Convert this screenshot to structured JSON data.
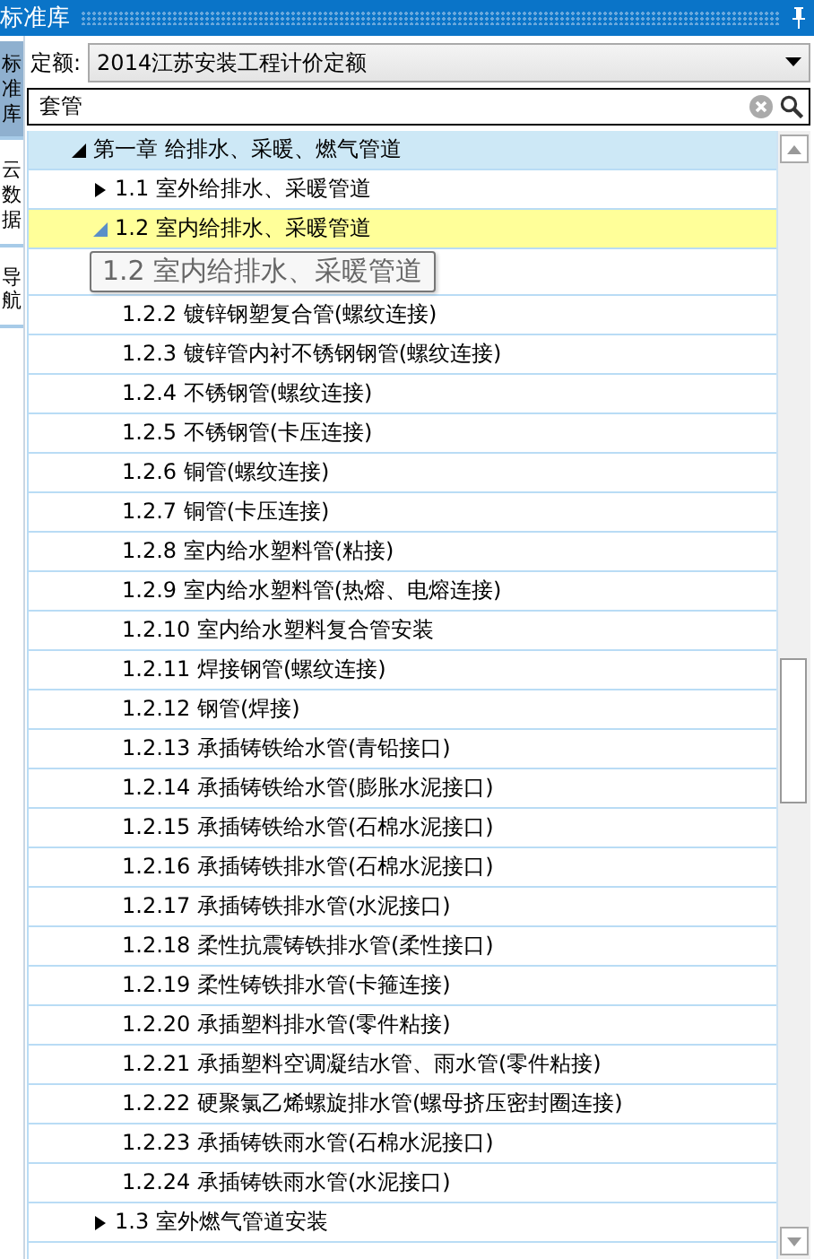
{
  "window": {
    "title": "标准库"
  },
  "side_tabs": [
    {
      "label": "标准库",
      "selected": true
    },
    {
      "label": "云数据",
      "selected": false
    },
    {
      "label": "导航",
      "selected": false
    }
  ],
  "quota": {
    "label": "定额:",
    "value": "2014江苏安装工程计价定额"
  },
  "search": {
    "value": "套管"
  },
  "tree": [
    {
      "label": "第一章 给排水、采暖、燃气管道",
      "expanded": true,
      "selected": false,
      "children": [
        {
          "label": "1.1 室外给排水、采暖管道",
          "expanded": false,
          "selected": false
        },
        {
          "label": "1.2 室内给排水、采暖管道",
          "expanded": true,
          "selected": true,
          "children": [
            {
              "label": "1.2.2 镀锌钢塑复合管(螺纹连接)",
              "selected": false
            },
            {
              "label": "1.2.3 镀锌管内衬不锈钢钢管(螺纹连接)",
              "selected": false
            },
            {
              "label": "1.2.4 不锈钢管(螺纹连接)",
              "selected": false
            },
            {
              "label": "1.2.5 不锈钢管(卡压连接)",
              "selected": false
            },
            {
              "label": "1.2.6 铜管(螺纹连接)",
              "selected": false
            },
            {
              "label": "1.2.7 铜管(卡压连接)",
              "selected": false
            },
            {
              "label": "1.2.8 室内给水塑料管(粘接)",
              "selected": false
            },
            {
              "label": "1.2.9 室内给水塑料管(热熔、电熔连接)",
              "selected": false
            },
            {
              "label": "1.2.10 室内给水塑料复合管安装",
              "selected": false
            },
            {
              "label": "1.2.11 焊接钢管(螺纹连接)",
              "selected": false
            },
            {
              "label": "1.2.12 钢管(焊接)",
              "selected": false
            },
            {
              "label": "1.2.13 承插铸铁给水管(青铅接口)",
              "selected": false
            },
            {
              "label": "1.2.14 承插铸铁给水管(膨胀水泥接口)",
              "selected": false
            },
            {
              "label": "1.2.15 承插铸铁给水管(石棉水泥接口)",
              "selected": false
            },
            {
              "label": "1.2.16 承插铸铁排水管(石棉水泥接口)",
              "selected": false
            },
            {
              "label": "1.2.17 承插铸铁排水管(水泥接口)",
              "selected": false
            },
            {
              "label": "1.2.18 柔性抗震铸铁排水管(柔性接口)",
              "selected": false
            },
            {
              "label": "1.2.19 柔性铸铁排水管(卡箍连接)",
              "selected": false
            },
            {
              "label": "1.2.20 承插塑料排水管(零件粘接)",
              "selected": false
            },
            {
              "label": "1.2.21 承插塑料空调凝结水管、雨水管(零件粘接)",
              "selected": false
            },
            {
              "label": "1.2.22 硬聚氯乙烯螺旋排水管(螺母挤压密封圈连接)",
              "selected": false
            },
            {
              "label": "1.2.23 承插铸铁雨水管(石棉水泥接口)",
              "selected": false
            },
            {
              "label": "1.2.24 承插铸铁雨水管(水泥接口)",
              "selected": false
            }
          ]
        },
        {
          "label": "1.3 室外燃气管道安装",
          "expanded": false,
          "selected": false
        }
      ]
    }
  ],
  "tooltip": "1.2 室内给排水、采暖管道"
}
